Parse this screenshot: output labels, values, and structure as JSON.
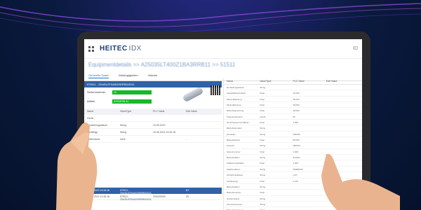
{
  "app": {
    "brand": "HEITEC",
    "brand_suffix": "IDX",
    "window_id": "ID"
  },
  "breadcrumb": "Equipmentdetails >> A25035LT400Z1BA3RRB11 >> 51511",
  "tabs": [
    {
      "label": "Generelle Daten",
      "active": true
    },
    {
      "label": "Abhängigkeiten",
      "active": false
    },
    {
      "label": "Historie",
      "active": false
    }
  ],
  "left": {
    "selected_id": "575111 - 2SASU3T5A002SRRB10011",
    "fields": [
      {
        "key": "Seriennummer",
        "value": "10"
      },
      {
        "key": "Artikel",
        "value": "SGS08T8L31"
      }
    ],
    "table": {
      "headers": [
        "Name",
        "ValueType",
        "PLC Value",
        "Edit Value"
      ],
      "rows": [
        [
          "Gerät",
          "",
          "",
          ""
        ],
        [
          "Herstellungsdatum",
          "String",
          "19.05.2022",
          ""
        ],
        [
          "Gerätetyp",
          "String",
          "19.05.2022 13:34:18",
          ""
        ],
        [
          "Artikelname",
          "int16",
          "",
          "-"
        ]
      ]
    },
    "history_title": "Historie",
    "history": [
      {
        "date": "19.05.2022 13:34:18",
        "id": "575111 - 2SASU3T5A002SRRB10011",
        "user": "",
        "status": "BT",
        "selected": true
      },
      {
        "date": "19.05.2022 13:35:18",
        "id": "575111 - 2SASU3T5A002SRRB10011",
        "user": "Z00000000",
        "status": "Z0",
        "selected": false
      }
    ]
  },
  "right": {
    "headers": [
      "Name",
      "ValueType",
      "PLC Value",
      "Edit Value"
    ],
    "rows": [
      [
        "Herstellungsdatum",
        "String",
        "",
        ""
      ],
      [
        "Kapazitätsverbrauch",
        "Float",
        "49.000",
        ""
      ],
      [
        "Maximalleistung",
        "Float",
        "48.000",
        ""
      ],
      [
        "Minimalleistung",
        "Float",
        "48.000",
        ""
      ],
      [
        "Betriebsspannung",
        "Float",
        "48.000",
        ""
      ],
      [
        "Frequenzbereich",
        "uint16",
        "50",
        ""
      ],
      [
        "Nennfrequenzverhältnis",
        "Float",
        "1.000",
        ""
      ],
      [
        "Betriebsstunden",
        "String",
        "",
        ""
      ],
      [
        "Hersteller",
        "String",
        "DEKRA",
        ""
      ],
      [
        "Betriebsstatus",
        "Float",
        "80.000",
        ""
      ],
      [
        "Gewicht",
        "String",
        "DEKRA",
        ""
      ],
      [
        "Seriennummer",
        "Float",
        "1.000",
        ""
      ],
      [
        "Betriebsdaten",
        "String",
        "dbs000",
        ""
      ],
      [
        "Kalibrierungsfaktor",
        "Float",
        "1.000",
        ""
      ],
      [
        "Kalibrierdatum",
        "String",
        "PREMIUM",
        ""
      ],
      [
        "Sicherheitsklasse",
        "String",
        "LCD",
        ""
      ],
      [
        "Gehäusetyp",
        "Float",
        "0.100",
        ""
      ],
      [
        "Betriebsdaten",
        "String",
        "",
        ""
      ],
      [
        "Betriebsmodus",
        "Float",
        "",
        ""
      ],
      [
        "Systemstatus",
        "String",
        "",
        ""
      ],
      [
        "Firmwareversion",
        "String",
        "",
        ""
      ],
      [
        "Betriebsspannung",
        "String",
        "",
        ""
      ],
      [
        "Betriebsspannung",
        "String",
        "",
        ""
      ]
    ]
  },
  "colors": {
    "accent": "#2f62a8",
    "status_green": "#17b82a",
    "background": "#0a1a3e"
  }
}
